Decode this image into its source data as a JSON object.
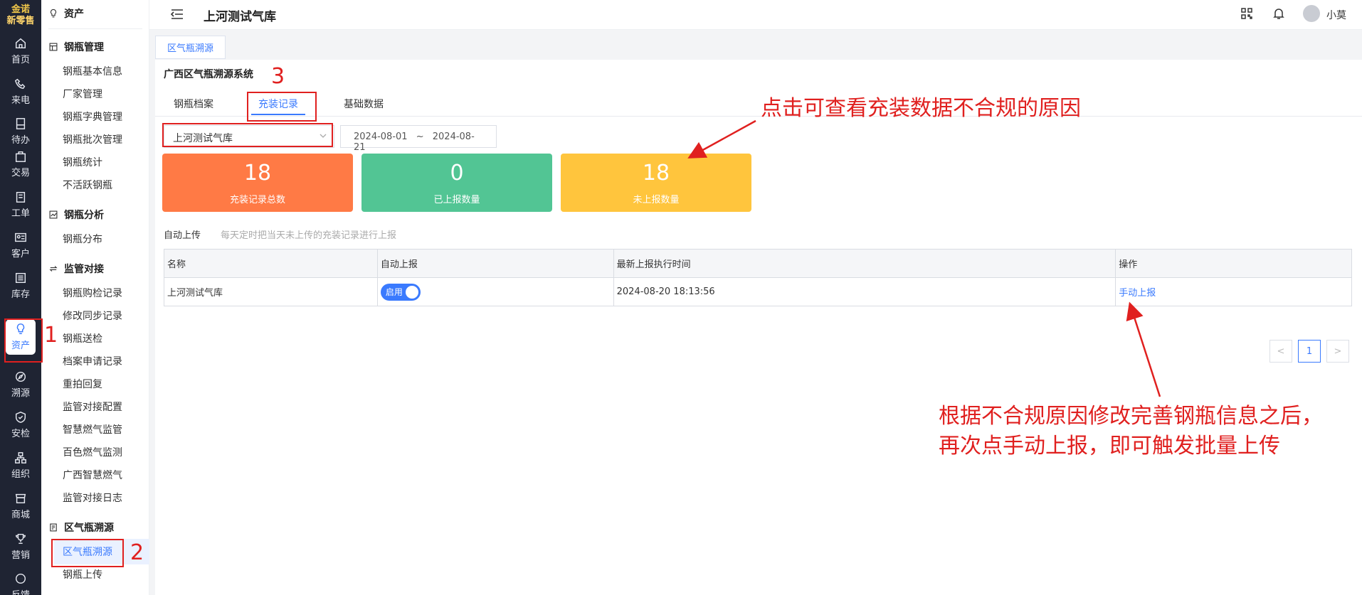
{
  "brand": {
    "line1": "金诺",
    "line2": "新零售"
  },
  "rail": [
    {
      "label": "首页",
      "icon": "home-icon"
    },
    {
      "label": "来电",
      "icon": "phone-icon"
    },
    {
      "label": "待办",
      "icon": "todo-icon"
    },
    {
      "label": "交易",
      "icon": "bag-icon"
    },
    {
      "label": "工单",
      "icon": "ticket-icon"
    },
    {
      "label": "客户",
      "icon": "id-card-icon"
    },
    {
      "label": "库存",
      "icon": "inventory-icon"
    },
    {
      "label": "资产",
      "icon": "bulb-icon"
    },
    {
      "label": "溯源",
      "icon": "compass-icon"
    },
    {
      "label": "安检",
      "icon": "shield-icon"
    },
    {
      "label": "组织",
      "icon": "org-icon"
    },
    {
      "label": "商城",
      "icon": "store-icon"
    },
    {
      "label": "营销",
      "icon": "trophy-icon"
    },
    {
      "label": "反馈",
      "icon": "chat-icon"
    }
  ],
  "submenu": {
    "title": "资产",
    "groups": [
      {
        "title": "钢瓶管理",
        "items": [
          "钢瓶基本信息",
          "厂家管理",
          "钢瓶字典管理",
          "钢瓶批次管理",
          "钢瓶统计",
          "不活跃钢瓶"
        ]
      },
      {
        "title": "钢瓶分析",
        "items": [
          "钢瓶分布"
        ]
      },
      {
        "title": "监管对接",
        "items": [
          "钢瓶购检记录",
          "修改同步记录",
          "钢瓶送检",
          "档案申请记录",
          "重拍回复",
          "监管对接配置",
          "智慧燃气监管",
          "百色燃气监测",
          "广西智慧燃气",
          "监管对接日志"
        ]
      },
      {
        "title": "区气瓶溯源",
        "items": [
          "区气瓶溯源",
          "钢瓶上传"
        ]
      }
    ]
  },
  "topbar": {
    "title": "上河测试气库",
    "user": "小莫"
  },
  "page_tab": "区气瓶溯源",
  "system_title": "广西区气瓶溯源系统",
  "tabs": [
    "钢瓶档案",
    "充装记录",
    "基础数据"
  ],
  "filters": {
    "station": "上河测试气库",
    "date_start": "2024-08-01",
    "date_sep": "~",
    "date_end": "2024-08-21"
  },
  "stats": [
    {
      "value": "18",
      "label": "充装记录总数",
      "color": "#ff7a45"
    },
    {
      "value": "0",
      "label": "已上报数量",
      "color": "#52c594"
    },
    {
      "value": "18",
      "label": "未上报数量",
      "color": "#ffc53d"
    }
  ],
  "auto_upload": {
    "label": "自动上传",
    "hint": "每天定时把当天未上传的充装记录进行上报"
  },
  "table": {
    "headers": [
      "名称",
      "自动上报",
      "最新上报执行时间",
      "操作"
    ],
    "rows": [
      {
        "name": "上河测试气库",
        "toggle": "启用",
        "time": "2024-08-20 18:13:56",
        "action": "手动上报"
      }
    ]
  },
  "pagination": {
    "prev": "<",
    "current": "1",
    "next": ">"
  },
  "annotations": {
    "n1": "1",
    "n2": "2",
    "n3": "3",
    "note1": "点击可查看充装数据不合规的原因",
    "note2_line1": "根据不合规原因修改完善钢瓶信息之后，",
    "note2_line2": "再次点手动上报，即可触发批量上传"
  },
  "accent": "#3a7afe",
  "annotation_color": "#e0201f"
}
